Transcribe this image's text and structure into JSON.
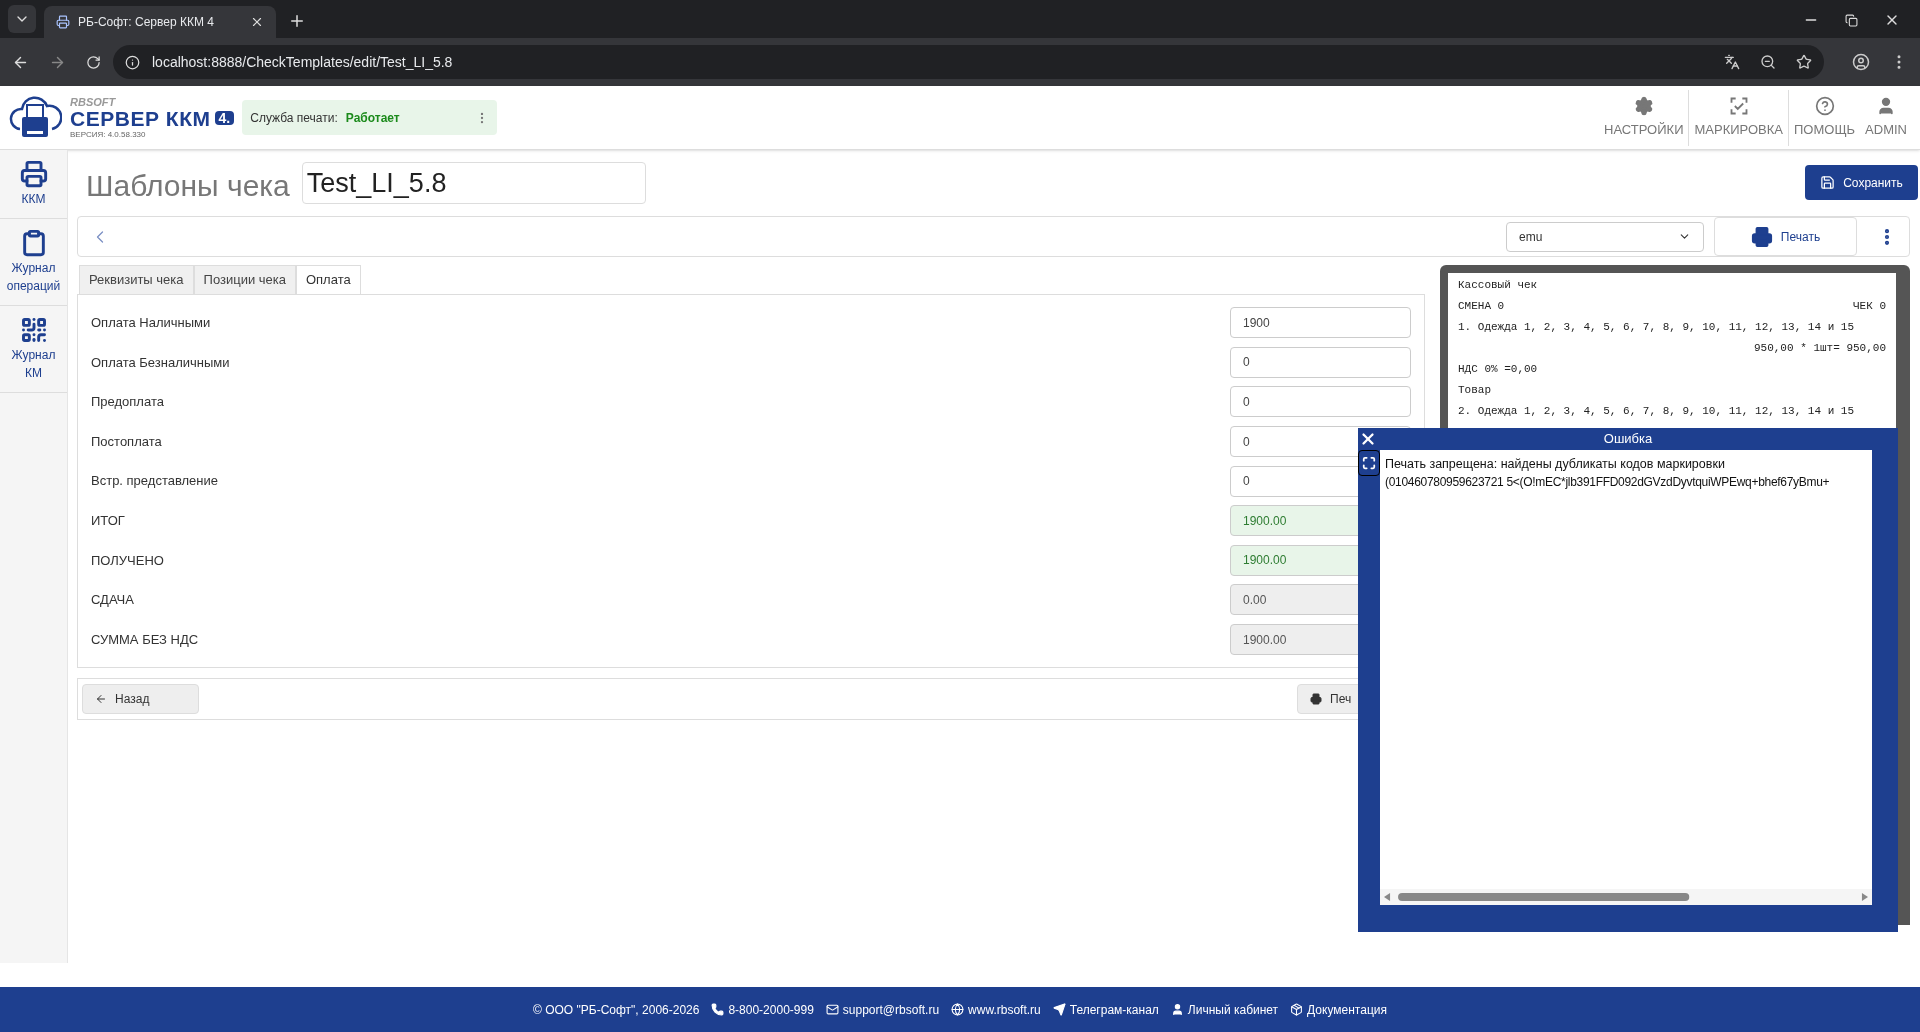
{
  "browser": {
    "tab_title": "РБ-Софт: Сервер ККМ 4",
    "url": "localhost:8888/CheckTemplates/edit/Test_LI_5.8"
  },
  "header": {
    "brand_small": "RBSOFT",
    "brand_name": "СЕРВЕР ККМ",
    "brand_version_badge": "4.",
    "version": "ВЕРСИЯ: 4.0.58.330",
    "service_label": "Служба печати:",
    "service_status": "Работает",
    "nav": [
      {
        "kind": "settings",
        "label": "НАСТРОЙКИ"
      },
      {
        "kind": "marking",
        "label": "МАРКИРОВКА"
      },
      {
        "kind": "help",
        "label": "ПОМОЩЬ"
      },
      {
        "kind": "user",
        "label": "ADMIN"
      }
    ]
  },
  "sidebar": [
    {
      "kind": "printer",
      "label": "ККМ"
    },
    {
      "kind": "clipboard",
      "label": "Журнал операций"
    },
    {
      "kind": "qr",
      "label": "Журнал КМ"
    }
  ],
  "page": {
    "title": "Шаблоны чека",
    "name_value": "Test_LI_5.8",
    "save_button": "Сохранить",
    "device_select": "emu",
    "print_button": "Печать"
  },
  "tabs": [
    {
      "label": "Реквизиты чека",
      "selected": false
    },
    {
      "label": "Позиции чека",
      "selected": false
    },
    {
      "label": "Оплата",
      "selected": true
    }
  ],
  "fields": [
    {
      "label": "Оплата Наличными",
      "value": "1900",
      "kind": "input"
    },
    {
      "label": "Оплата Безналичными",
      "value": "0",
      "kind": "input"
    },
    {
      "label": "Предоплата",
      "value": "0",
      "kind": "input"
    },
    {
      "label": "Постоплата",
      "value": "0",
      "kind": "input"
    },
    {
      "label": "Встр. представление",
      "value": "0",
      "kind": "input"
    },
    {
      "label": "ИТОГ",
      "value": "1900.00",
      "kind": "total"
    },
    {
      "label": "ПОЛУЧЕНО",
      "value": "1900.00",
      "kind": "total"
    },
    {
      "label": "СДАЧА",
      "value": "0.00",
      "kind": "readonly"
    },
    {
      "label": "СУММА БЕЗ НДС",
      "value": "1900.00",
      "kind": "readonly"
    }
  ],
  "bottom_bar": {
    "back_button": "Назад",
    "print_button": "Печ"
  },
  "receipt": [
    {
      "kind": "left",
      "text": "Кассовый чек"
    },
    {
      "kind": "split",
      "left": "СМЕНА 0",
      "right": "ЧЕК 0"
    },
    {
      "kind": "left",
      "text": "1. Одежда 1, 2, 3, 4, 5, 6, 7, 8, 9, 10, 11, 12, 13, 14 и 15"
    },
    {
      "kind": "right",
      "text": "950,00 * 1шт= 950,00"
    },
    {
      "kind": "left",
      "text": "НДС 0% =0,00"
    },
    {
      "kind": "left",
      "text": "Товар"
    },
    {
      "kind": "left",
      "text": "2. Одежда 1, 2, 3, 4, 5, 6, 7, 8, 9, 10, 11, 12, 13, 14 и 15"
    }
  ],
  "error_dialog": {
    "title": "Ошибка",
    "message_line_1": "Печать запрещена: найдены дубликаты кодов маркировки",
    "message_line_2": "(010460780959623721 5<(O!mEC*jlb391FFD092dGVzdDyvtquiWPEwq+bhef67yBmu+"
  },
  "footer": [
    {
      "kind": "copyright",
      "text": "© ООО \"РБ-Софт\", 2006-2026"
    },
    {
      "kind": "phone",
      "text": "8-800-2000-999"
    },
    {
      "kind": "mail",
      "text": "support@rbsoft.ru"
    },
    {
      "kind": "globe",
      "text": "www.rbsoft.ru"
    },
    {
      "kind": "send",
      "text": "Телеграм-канал"
    },
    {
      "kind": "user",
      "text": "Личный кабинет"
    },
    {
      "kind": "box",
      "text": "Документация"
    }
  ]
}
